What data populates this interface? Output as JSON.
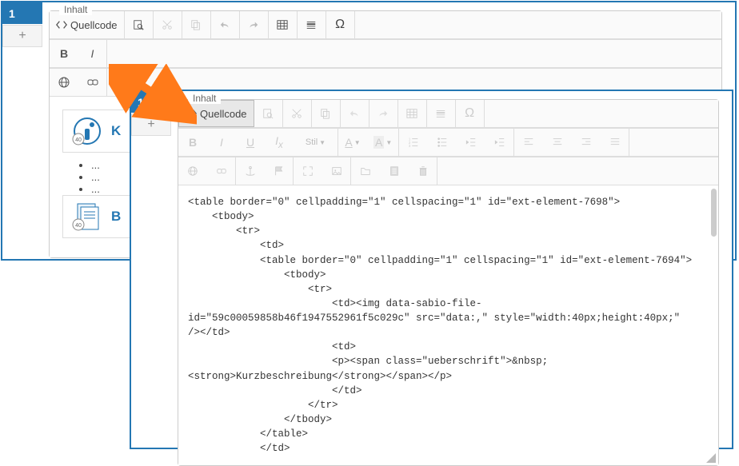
{
  "back": {
    "tab_label": "1",
    "add_label": "+",
    "legend": "Inhalt",
    "source_label": "Quellcode",
    "preview": {
      "card1_title": "K",
      "li1": "...",
      "li2": "...",
      "li3": "...",
      "card2_title": "B",
      "badge": "40"
    }
  },
  "front": {
    "tab_label": "1",
    "add_label": "+",
    "legend": "Inhalt",
    "source_label": "Quellcode",
    "stil_label": "Stil",
    "code": "<table border=\"0\" cellpadding=\"1\" cellspacing=\"1\" id=\"ext-element-7698\">\n    <tbody>\n        <tr>\n            <td>\n            <table border=\"0\" cellpadding=\"1\" cellspacing=\"1\" id=\"ext-element-7694\">\n                <tbody>\n                    <tr>\n                        <td><img data-sabio-file-\nid=\"59c00059858b46f1947552961f5c029c\" src=\"data:,\" style=\"width:40px;height:40px;\"\n/></td>\n                        <td>\n                        <p><span class=\"ueberschrift\">&nbsp;\n<strong>Kurzbeschreibung</strong></span></p>\n                        </td>\n                    </tr>\n                </tbody>\n            </table>\n            </td>"
  }
}
